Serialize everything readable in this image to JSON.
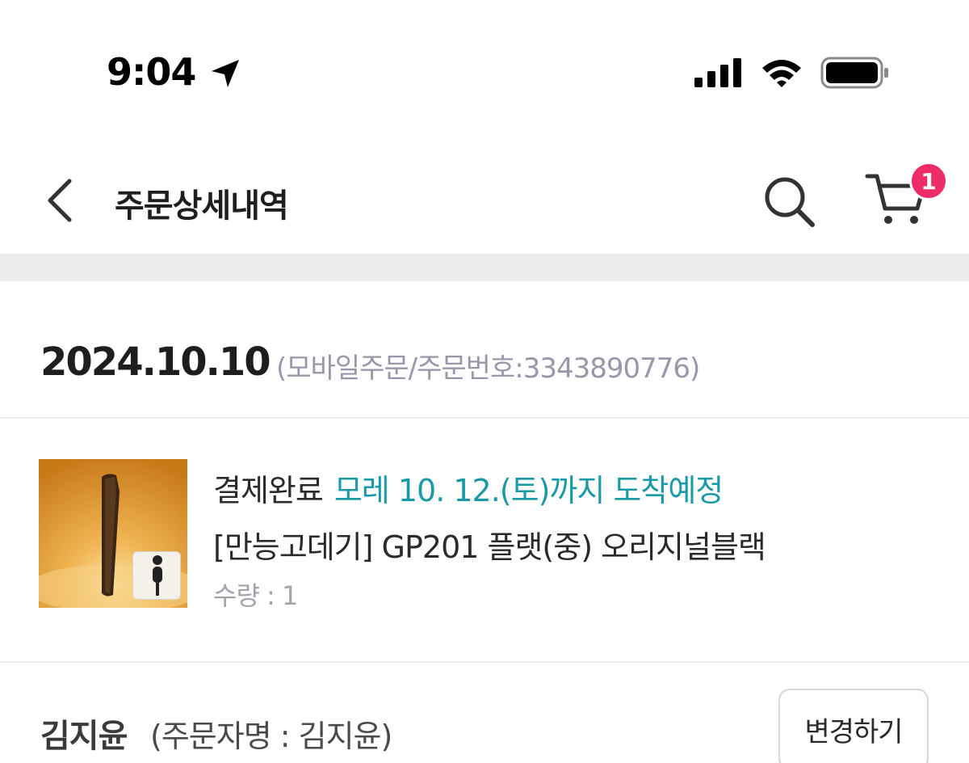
{
  "status_bar": {
    "time": "9:04",
    "icons": [
      "location-arrow-icon",
      "signal-icon",
      "wifi-icon",
      "battery-icon"
    ]
  },
  "nav": {
    "title": "주문상세내역",
    "cart_count": "1",
    "icons": [
      "back-chevron-icon",
      "search-icon",
      "cart-icon"
    ]
  },
  "order": {
    "date": "2024.10.10",
    "meta": "(모바일주문/주문번호:3343890776)"
  },
  "item": {
    "status": "결제완료",
    "eta": "모레 10. 12.(토)까지 도착예정",
    "name": "[만능고데기] GP201 플랫(중) 오리지널블랙",
    "quantity": "수량 : 1"
  },
  "orderer": {
    "name": "김지윤",
    "note": "(주문자명 : 김지윤)",
    "change_label": "변경하기"
  },
  "colors": {
    "accent_teal": "#1a9aa6",
    "badge_pink": "#ee2c67",
    "muted_text": "#9a97ab",
    "divider": "#ececee"
  }
}
